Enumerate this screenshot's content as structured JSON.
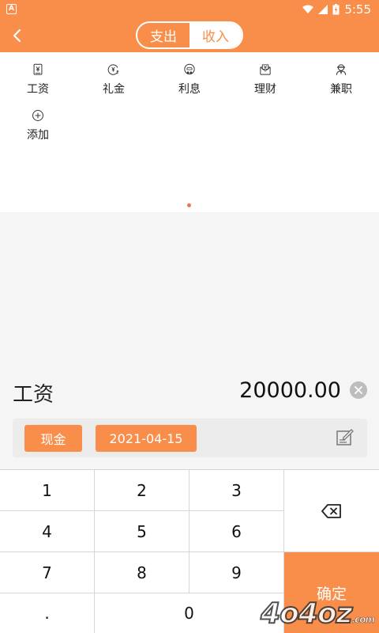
{
  "status_bar": {
    "time": "5:55",
    "notification_glyph": "A"
  },
  "header": {
    "tabs": [
      {
        "label": "支出",
        "active": false
      },
      {
        "label": "收入",
        "active": true
      }
    ],
    "accent_color": "#f98e4b"
  },
  "categories": [
    {
      "label": "工资",
      "icon": "salary-icon"
    },
    {
      "label": "礼金",
      "icon": "gift-money-icon"
    },
    {
      "label": "利息",
      "icon": "interest-icon"
    },
    {
      "label": "理财",
      "icon": "investment-icon"
    },
    {
      "label": "兼职",
      "icon": "part-time-icon"
    },
    {
      "label": "添加",
      "icon": "add-icon"
    }
  ],
  "entry": {
    "category": "工资",
    "amount": "20000.00"
  },
  "meta": {
    "account": "现金",
    "date": "2021-04-15"
  },
  "keypad": {
    "keys": [
      "1",
      "2",
      "3",
      "4",
      "5",
      "6",
      "7",
      "8",
      "9",
      ".",
      "0"
    ],
    "confirm_label": "确定"
  },
  "watermark": {
    "text": "4o4oz",
    "suffix": ".com"
  }
}
